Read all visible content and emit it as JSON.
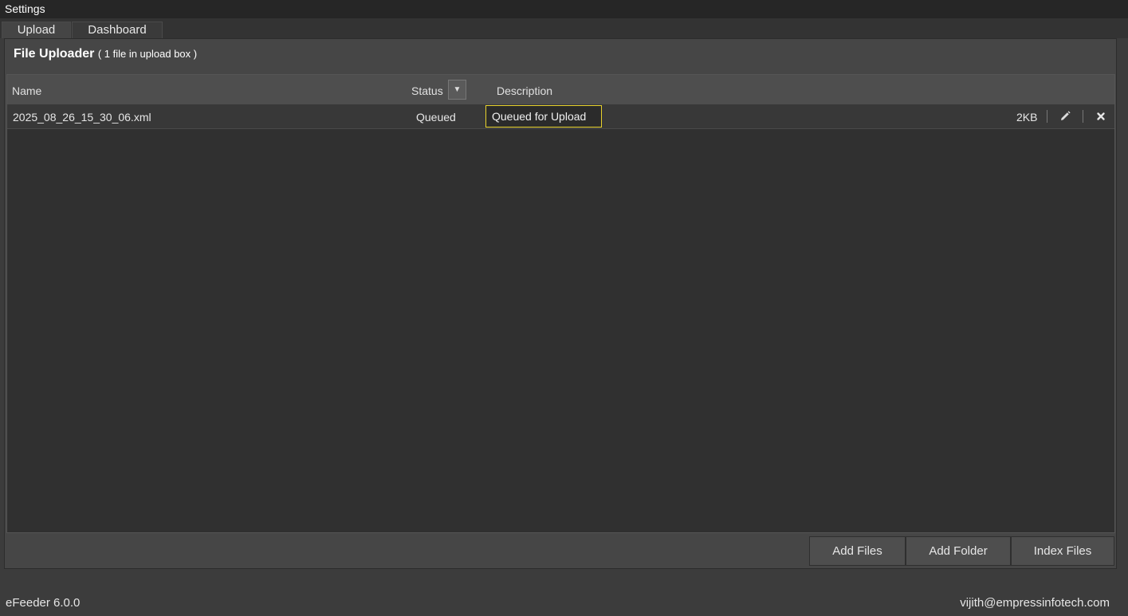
{
  "window": {
    "title": "Settings"
  },
  "tabs": [
    {
      "label": "Upload",
      "active": true
    },
    {
      "label": "Dashboard",
      "active": false
    }
  ],
  "uploader": {
    "title": "File Uploader",
    "count_text": "( 1 file in upload box )",
    "columns": {
      "name": "Name",
      "status": "Status",
      "description": "Description"
    },
    "rows": [
      {
        "name": "2025_08_26_15_30_06.xml",
        "status": "Queued",
        "description": "Queued for Upload",
        "size": "2KB"
      }
    ],
    "icons": {
      "filter": "filter-dropdown-icon",
      "edit": "pencil-icon",
      "remove": "close-icon"
    }
  },
  "buttons": {
    "add_files": "Add Files",
    "add_folder": "Add Folder",
    "index_files": "Index Files"
  },
  "status_bar": {
    "version": "eFeeder 6.0.0",
    "user": "vijith@empressinfotech.com"
  },
  "colors": {
    "accent_focus": "#e8d22c",
    "background": "#3c3c3c"
  }
}
